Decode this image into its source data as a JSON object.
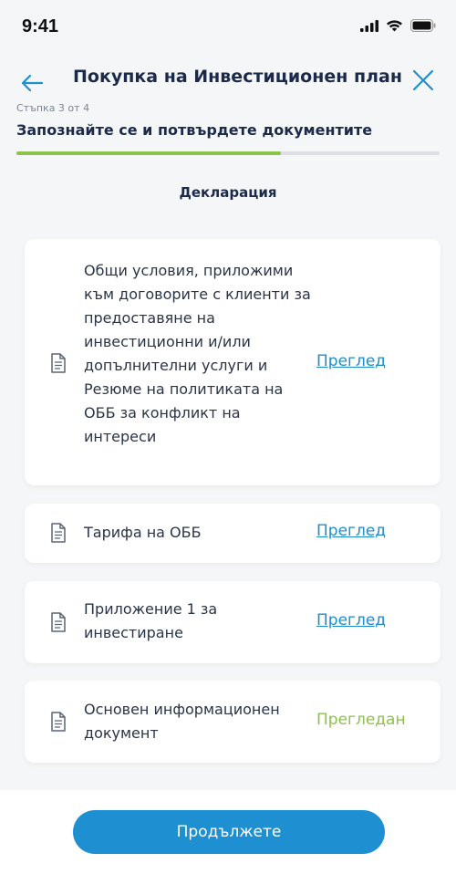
{
  "status_bar": {
    "time": "9:41"
  },
  "header": {
    "title": "Покупка на Инвестиционен план",
    "step_label": "Стъпка 3 от 4",
    "step_title": "Запознайте се и потвърдете документите",
    "progress_fraction": 0.625
  },
  "section": {
    "title": "Декларация"
  },
  "documents": [
    {
      "text": "Общи условия, приложими към договорите с клиенти за предоставяне на инвестиционни и/или допълнителни услуги и Резюме на политиката на ОББ за конфликт на интереси",
      "action": "Преглед",
      "reviewed": false
    },
    {
      "text": "Тарифа на ОББ",
      "action": "Преглед",
      "reviewed": false
    },
    {
      "text": "Приложение 1 за инвестиране",
      "action": "Преглед",
      "reviewed": false
    },
    {
      "text": "Основен информационен документ",
      "action": "Прегледан",
      "reviewed": true
    }
  ],
  "footer": {
    "continue_label": "Продължете"
  },
  "colors": {
    "accent": "#1e8fd0",
    "link": "#1c8ec9",
    "success": "#8bc34a",
    "title": "#1c2a4a",
    "background": "#f5f6f8"
  },
  "icons": [
    "cellular-signal-icon",
    "wifi-icon",
    "battery-icon",
    "back-arrow-icon",
    "close-icon",
    "document-icon"
  ]
}
